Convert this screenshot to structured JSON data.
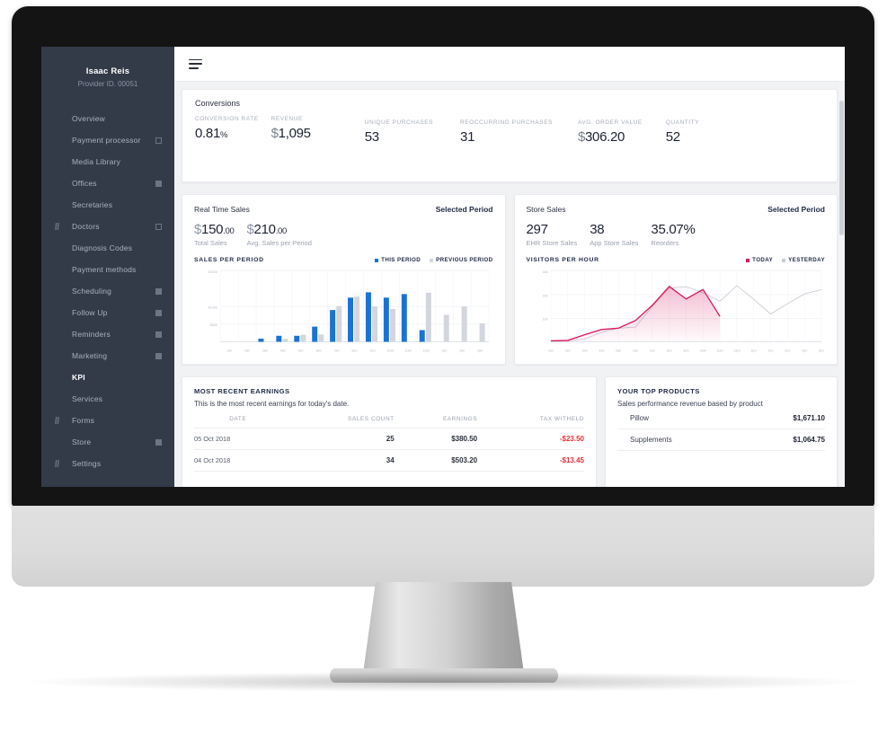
{
  "sidebar": {
    "brand": {
      "name": "Isaac Reis",
      "sub": "Provider ID. 00051"
    },
    "items": [
      {
        "label": "Overview",
        "icon": "",
        "badge": "none",
        "active": false
      },
      {
        "label": "Payment processor",
        "icon": "",
        "badge": "square",
        "active": false
      },
      {
        "label": "Media Library",
        "icon": "",
        "badge": "none",
        "active": false
      },
      {
        "label": "Offices",
        "icon": "",
        "badge": "filled",
        "active": false
      },
      {
        "label": "Secretaries",
        "icon": "",
        "badge": "none",
        "active": false
      },
      {
        "label": "Doctors",
        "icon": "doctor-icon",
        "badge": "square",
        "active": false
      },
      {
        "label": "Diagnosis Codes",
        "icon": "",
        "badge": "none",
        "active": false
      },
      {
        "label": "Payment methods",
        "icon": "",
        "badge": "none",
        "active": false
      },
      {
        "label": "Scheduling",
        "icon": "",
        "badge": "filled",
        "active": false
      },
      {
        "label": "Follow Up",
        "icon": "",
        "badge": "filled",
        "active": false
      },
      {
        "label": "Reminders",
        "icon": "",
        "badge": "filled",
        "active": false
      },
      {
        "label": "Marketing",
        "icon": "",
        "badge": "filled",
        "active": false
      },
      {
        "label": "KPI",
        "icon": "",
        "badge": "none",
        "active": true
      },
      {
        "label": "Services",
        "icon": "",
        "badge": "none",
        "active": false
      },
      {
        "label": "Forms",
        "icon": "forms-icon",
        "badge": "none",
        "active": false
      },
      {
        "label": "Store",
        "icon": "",
        "badge": "filled",
        "active": false
      },
      {
        "label": "Settings",
        "icon": "settings-icon",
        "badge": "none",
        "active": false
      }
    ]
  },
  "topbar": {
    "menu_icon": "hamburger-icon"
  },
  "conversions": {
    "title": "Conversions",
    "metrics": [
      {
        "label": "CONVERSION RATE",
        "value": "0.81",
        "suffix": "%",
        "prefix": ""
      },
      {
        "label": "REVENUE",
        "value": "1,095",
        "suffix": "",
        "prefix": "$"
      },
      {
        "label": "UNIQUE PURCHASES",
        "value": "53",
        "suffix": "",
        "prefix": ""
      },
      {
        "label": "REOCCURRING PURCHASES",
        "value": "31",
        "suffix": "",
        "prefix": ""
      },
      {
        "label": "AVG. ORDER VALUE",
        "value": "306.20",
        "suffix": "",
        "prefix": "$"
      },
      {
        "label": "QUANTITY",
        "value": "52",
        "suffix": "",
        "prefix": ""
      }
    ]
  },
  "real_time_sales": {
    "title": "Real Time Sales",
    "action": "Selected Period",
    "stats": [
      {
        "currency": "$",
        "int": "150",
        "dec": ".00",
        "caption": "Total Sales"
      },
      {
        "currency": "$",
        "int": "210",
        "dec": ".00",
        "caption": "Avg. Sales per Period"
      }
    ],
    "chart_label": "SALES PER PERIOD",
    "legend": [
      {
        "name": "THIS PERIOD",
        "color": "#1a73d4"
      },
      {
        "name": "PREVIOUS PERIOD",
        "color": "#d3d6dc"
      }
    ]
  },
  "store_sales": {
    "title": "Store Sales",
    "action": "Selected Period",
    "stats": [
      {
        "value": "297",
        "caption": "EHR Store Sales"
      },
      {
        "value": "38",
        "caption": "App Store Sales"
      },
      {
        "value": "35.07%",
        "caption": "Reorders"
      }
    ],
    "chart_label": "VISITORS PER HOUR",
    "legend": [
      {
        "name": "TODAY",
        "color": "#d81b60"
      },
      {
        "name": "YESTERDAY",
        "color": "#c9ccd3"
      }
    ]
  },
  "earnings": {
    "title": "MOST RECENT EARNINGS",
    "subtitle": "This is the most recent earnings for today's date.",
    "columns": [
      "DATE",
      "SALES COUNT",
      "EARNINGS",
      "TAX WITHELD"
    ],
    "rows": [
      {
        "date": "05 Oct 2018",
        "count": "25",
        "earnings": "$380.50",
        "tax": "-$23.50"
      },
      {
        "date": "04 Oct 2018",
        "count": "34",
        "earnings": "$503.20",
        "tax": "-$13.45"
      }
    ]
  },
  "top_products": {
    "title": "YOUR TOP PRODUCTS",
    "subtitle": "Sales performance revenue based by product",
    "rows": [
      {
        "name": "Pillow",
        "value": "$1,671.10"
      },
      {
        "name": "Supplements",
        "value": "$1,064.75"
      }
    ]
  },
  "chart_data": [
    {
      "type": "bar",
      "title": "SALES PER PERIOD",
      "xlabel": "",
      "ylabel": "",
      "ylim": [
        0,
        2000
      ],
      "yticks": [
        "$500",
        "$1000",
        "$2000"
      ],
      "grid": true,
      "legend_position": "top-right",
      "categories": [
        "1am",
        "2am",
        "3am",
        "4am",
        "5am",
        "6am",
        "7am",
        "8am",
        "9am",
        "10am",
        "11am",
        "12pm",
        "1pm",
        "2pm",
        "3pm"
      ],
      "series": [
        {
          "name": "THIS PERIOD",
          "color": "#1a73d4",
          "values": [
            0,
            0,
            90,
            170,
            170,
            430,
            900,
            1250,
            1400,
            1250,
            1350,
            330,
            0,
            0,
            0
          ]
        },
        {
          "name": "PREVIOUS PERIOD",
          "color": "#d3d6dc",
          "values": [
            0,
            0,
            0,
            80,
            200,
            210,
            1010,
            1280,
            1000,
            930,
            0,
            1390,
            760,
            1000,
            520
          ]
        }
      ]
    },
    {
      "type": "area",
      "title": "VISITORS PER HOUR",
      "xlabel": "",
      "ylabel": "",
      "ylim": [
        0,
        300
      ],
      "yticks": [
        "100",
        "200",
        "300"
      ],
      "grid": true,
      "legend_position": "top-right",
      "categories": [
        "1am",
        "2am",
        "3am",
        "4am",
        "5am",
        "6am",
        "7am",
        "8am",
        "9am",
        "10am",
        "11am",
        "12pm",
        "1pm",
        "2pm",
        "3pm",
        "4pm",
        "5pm"
      ],
      "series": [
        {
          "name": "TODAY",
          "color": "#d81b60",
          "values": [
            4,
            6,
            30,
            52,
            58,
            90,
            155,
            235,
            182,
            222,
            108,
            null,
            null,
            null,
            null,
            null,
            null
          ]
        },
        {
          "name": "YESTERDAY",
          "color": "#c9ccd3",
          "values": [
            2,
            3,
            12,
            40,
            58,
            62,
            150,
            228,
            234,
            208,
            172,
            238,
            180,
            118,
            162,
            203,
            222
          ]
        }
      ]
    }
  ]
}
